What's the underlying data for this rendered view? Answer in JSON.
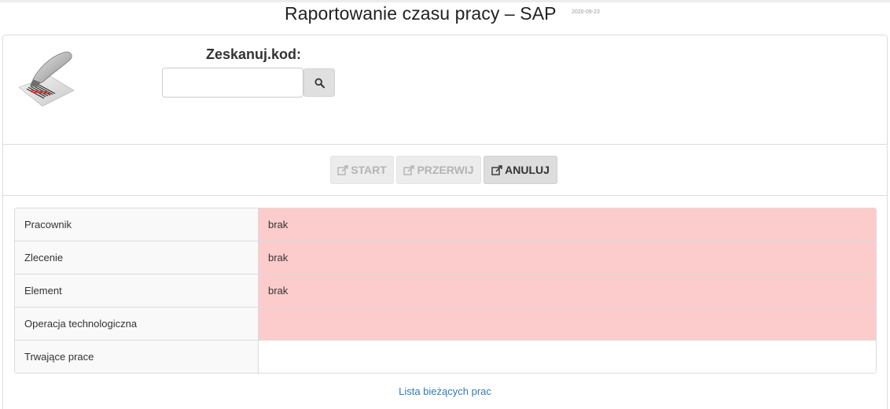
{
  "header": {
    "title": "Raportowanie czasu pracy – SAP",
    "date": "2020-09-23"
  },
  "scan": {
    "label": "Zeskanuj.kod:",
    "input_value": "",
    "input_placeholder": "",
    "search_icon": "search-icon"
  },
  "actions": {
    "start_label": "START",
    "przerwij_label": "PRZERWIJ",
    "anuluj_label": "ANULUJ",
    "icon": "external-link-icon"
  },
  "info_rows": [
    {
      "label": "Pracownik",
      "value": "brak",
      "status": "error"
    },
    {
      "label": "Zlecenie",
      "value": "brak",
      "status": "error"
    },
    {
      "label": "Element",
      "value": "brak",
      "status": "error"
    },
    {
      "label": "Operacja technologiczna",
      "value": "",
      "status": "error"
    },
    {
      "label": "Trwające prace",
      "value": "",
      "status": "ok"
    }
  ],
  "links": {
    "current_jobs": "Lista bieżących prac"
  },
  "colors": {
    "error_bg": "#fccbcb",
    "link": "#337ab7",
    "disabled_btn_bg": "#ececec",
    "enabled_btn_bg": "#dddddd"
  }
}
